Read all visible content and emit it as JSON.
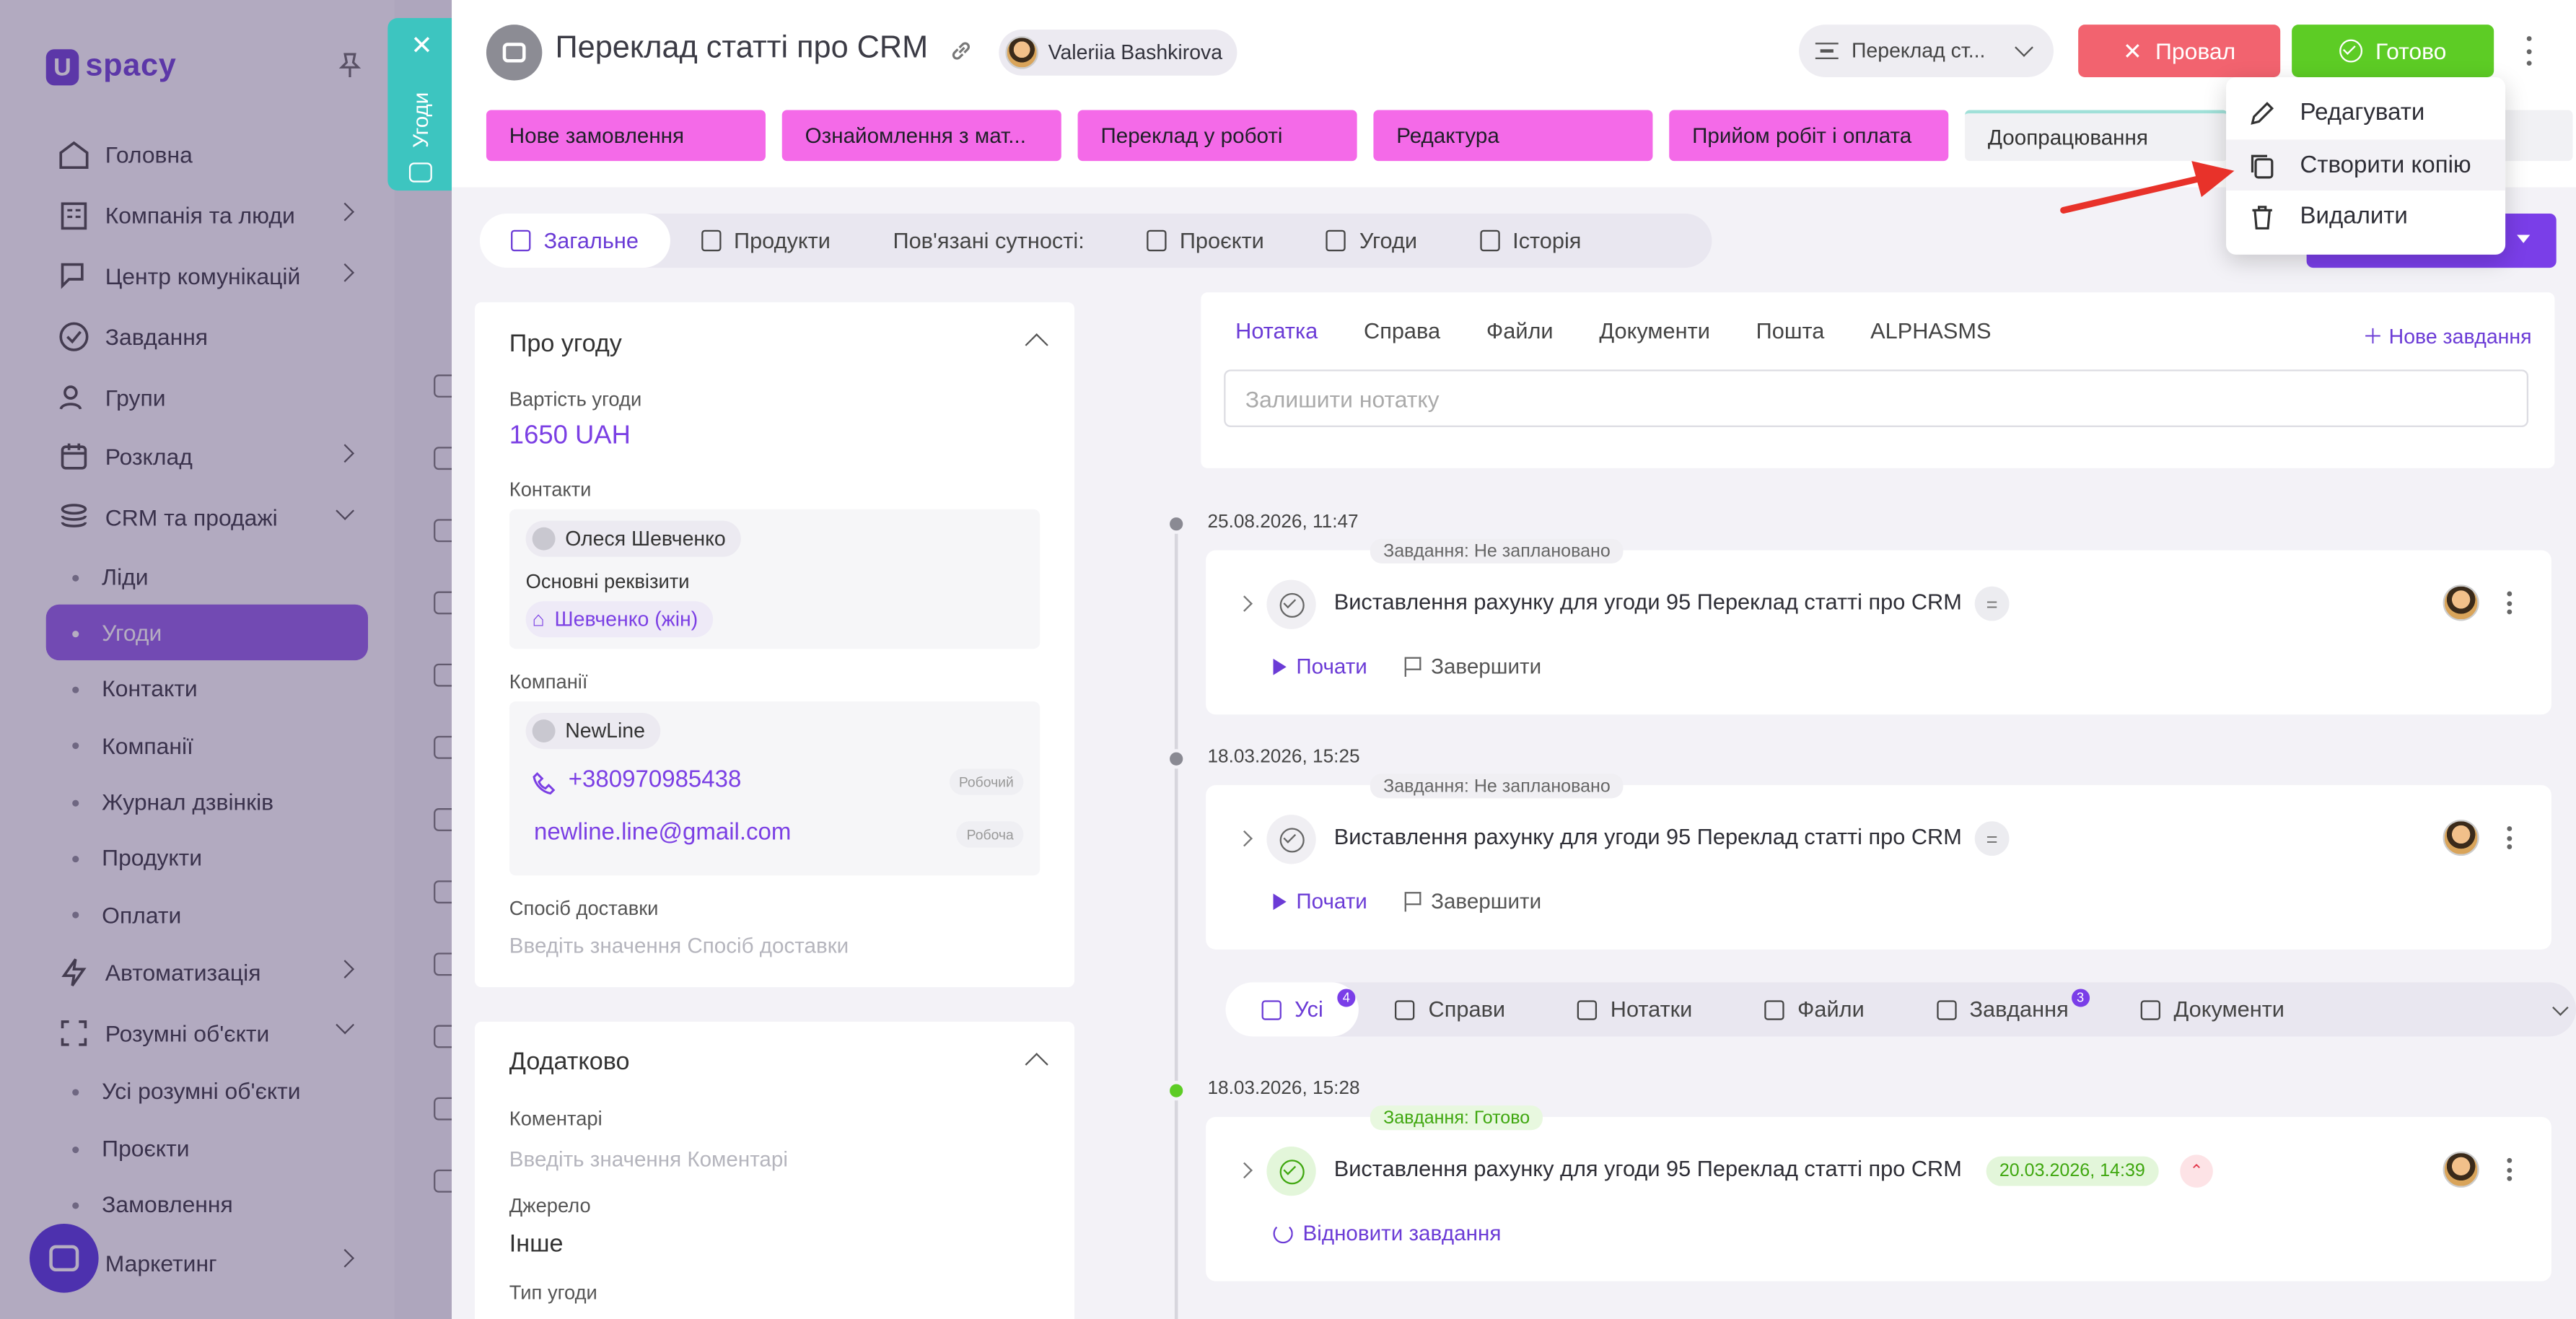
{
  "sidebar": {
    "logo": "spacy",
    "items": [
      {
        "label": "Головна",
        "icon": "home-icon"
      },
      {
        "label": "Компанія та люди",
        "icon": "building-icon",
        "chevron": true
      },
      {
        "label": "Центр комунікацій",
        "icon": "chat-edit-icon",
        "chevron": true
      },
      {
        "label": "Завдання",
        "icon": "check-circle-icon"
      },
      {
        "label": "Групи",
        "icon": "users-icon"
      },
      {
        "label": "Розклад",
        "icon": "calendar-icon",
        "chevron": true
      },
      {
        "label": "CRM та продажі",
        "icon": "stack-icon",
        "expanded": true
      }
    ],
    "crm_sub": [
      "Ліди",
      "Угоди",
      "Контакти",
      "Компанії",
      "Журнал дзвінків",
      "Продукти",
      "Оплати"
    ],
    "items2": [
      {
        "label": "Автоматизація",
        "icon": "bolt-icon",
        "chevron": true
      },
      {
        "label": "Розумні об'єкти",
        "icon": "scan-icon",
        "expanded": true
      }
    ],
    "smart_sub": [
      "Усі розумні об'єкти",
      "Проєкти",
      "Замовлення"
    ],
    "items3": [
      {
        "label": "Маркетинг",
        "icon": "megaphone-icon",
        "chevron": true
      }
    ]
  },
  "side_tab": {
    "label": "Угоди"
  },
  "header": {
    "title": "Переклад статті про CRM",
    "owner": "Valeriia Bashkirova",
    "funnel": "Переклад ст...",
    "fail_label": "Провал",
    "done_label": "Готово"
  },
  "stages": [
    "Нове замовлення",
    "Ознайомлення з мат...",
    "Переклад у роботі",
    "Редактура",
    "Прийом робіт і оплата",
    "Доопрацювання",
    ""
  ],
  "tabs": [
    {
      "label": "Загальне",
      "icon": "list-icon",
      "active": true
    },
    {
      "label": "Продукти",
      "icon": "box-icon"
    },
    {
      "label": "Пов'язані сутності:",
      "icon": ""
    },
    {
      "label": "Проєкти",
      "icon": "scan-icon"
    },
    {
      "label": "Угоди",
      "icon": "handshake-icon"
    },
    {
      "label": "Історія",
      "icon": "list-lines-icon"
    }
  ],
  "about": {
    "title": "Про угоду",
    "value_label": "Вартість угоди",
    "value": "1650 UAH",
    "contacts_label": "Контакти",
    "contact_name": "Олеся Шевченко",
    "requisites_label": "Основні реквізити",
    "requisite": "Шевченко (жін)",
    "companies_label": "Компанії",
    "company_name": "NewLine",
    "phone": "+380970985438",
    "phone_tag": "Робочий",
    "email": "newline.line@gmail.com",
    "email_tag": "Робоча",
    "delivery_label": "Спосіб доставки",
    "delivery_placeholder": "Введіть значення Спосіб доставки"
  },
  "extra": {
    "title": "Додатково",
    "comments_label": "Коментарі",
    "comments_placeholder": "Введіть значення Коментарі",
    "source_label": "Джерело",
    "source_value": "Інше",
    "type_label": "Тип угоди"
  },
  "composer": {
    "tabs": [
      "Нотатка",
      "Справа",
      "Файли",
      "Документи",
      "Пошта",
      "ALPHASMS"
    ],
    "new_task": "Нове завдання",
    "placeholder": "Залишити нотатку"
  },
  "timeline": [
    {
      "date": "25.08.2026, 11:47",
      "badge": "Завдання: Не заплановано",
      "title": "Виставлення рахунку для угоди 95 Переклад статті про CRM",
      "start": "Почати",
      "finish": "Завершити"
    },
    {
      "date": "18.03.2026, 15:25",
      "badge": "Завдання: Не заплановано",
      "title": "Виставлення рахунку для угоди 95 Переклад статті про CRM",
      "start": "Почати",
      "finish": "Завершити"
    },
    {
      "date": "18.03.2026, 15:28",
      "badge": "Завдання: Готово",
      "title": "Виставлення рахунку для угоди 95 Переклад статті про CRM",
      "deadline": "20.03.2026, 14:39",
      "restore": "Відновити завдання"
    }
  ],
  "filters": [
    {
      "label": "Усі",
      "count": "4",
      "icon": "list-icon",
      "active": true
    },
    {
      "label": "Справи",
      "icon": "calendar-icon"
    },
    {
      "label": "Нотатки",
      "icon": "note-icon"
    },
    {
      "label": "Файли",
      "icon": "file-icon"
    },
    {
      "label": "Завдання",
      "count": "3",
      "icon": "check-circle-icon"
    },
    {
      "label": "Документи",
      "icon": "document-icon"
    }
  ],
  "menu": {
    "edit": "Редагувати",
    "copy": "Створити копію",
    "delete": "Видалити"
  },
  "colors": {
    "accent": "#6b3bd6",
    "stage_active": "#f46ae8",
    "fail": "#f2636f",
    "done": "#5dcc25",
    "side_tab": "#3dc5c0",
    "arrow": "#e8322a"
  }
}
